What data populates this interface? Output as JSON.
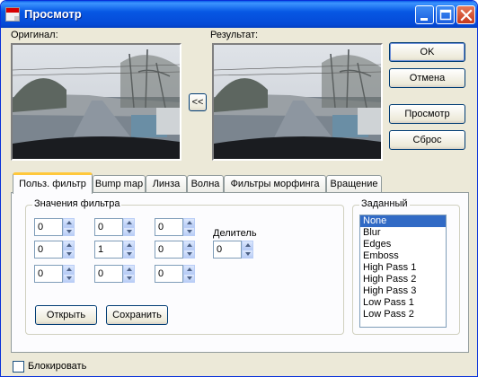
{
  "window": {
    "title": "Просмотр"
  },
  "labels": {
    "original": "Оригинал:",
    "result": "Результат:"
  },
  "copy_button": "<<",
  "buttons": {
    "ok": "OK",
    "cancel": "Отмена",
    "preview": "Просмотр",
    "reset": "Сброс"
  },
  "tabs": [
    {
      "label": "Польз. фильтр"
    },
    {
      "label": "Bump map"
    },
    {
      "label": "Линза"
    },
    {
      "label": "Волна"
    },
    {
      "label": "Фильтры морфинга"
    },
    {
      "label": "Вращение"
    }
  ],
  "active_tab": "Польз. фильтр",
  "filter": {
    "group_title": "Значения фильтра",
    "matrix": [
      [
        "0",
        "0",
        "0"
      ],
      [
        "0",
        "1",
        "0"
      ],
      [
        "0",
        "0",
        "0"
      ]
    ],
    "divisor_label": "Делитель",
    "divisor": "0",
    "open_label": "Открыть",
    "save_label": "Сохранить"
  },
  "preset": {
    "group_title": "Заданный",
    "items": [
      "None",
      "Blur",
      "Edges",
      "Emboss",
      "High Pass 1",
      "High Pass 2",
      "High Pass 3",
      "Low Pass 1",
      "Low Pass 2"
    ],
    "selected": "None"
  },
  "lock": {
    "label": "Блокировать",
    "checked": false
  },
  "icons": {
    "app": "app-document-icon",
    "minimize": "minimize-icon",
    "maximize": "maximize-icon",
    "close": "close-icon"
  },
  "colors": {
    "titlebar": "#0458e0",
    "face": "#ece9d8",
    "selection": "#316ac5",
    "active_tab_accent": "#ffc83c"
  }
}
